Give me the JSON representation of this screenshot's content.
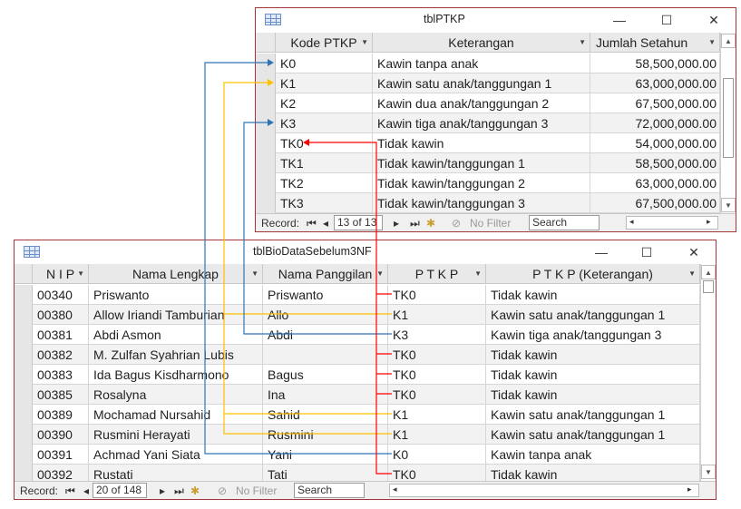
{
  "ptkp": {
    "title": "tblPTKP",
    "columns": [
      "Kode PTKP",
      "Keterangan",
      "Jumlah Setahun"
    ],
    "rows": [
      {
        "kode": "K0",
        "ket": "Kawin tanpa anak",
        "jumlah": "58,500,000.00"
      },
      {
        "kode": "K1",
        "ket": "Kawin satu anak/tanggungan 1",
        "jumlah": "63,000,000.00"
      },
      {
        "kode": "K2",
        "ket": "Kawin dua anak/tanggungan 2",
        "jumlah": "67,500,000.00"
      },
      {
        "kode": "K3",
        "ket": "Kawin tiga anak/tanggungan 3",
        "jumlah": "72,000,000.00"
      },
      {
        "kode": "TK0",
        "ket": "Tidak kawin",
        "jumlah": "54,000,000.00"
      },
      {
        "kode": "TK1",
        "ket": "Tidak kawin/tanggungan 1",
        "jumlah": "58,500,000.00"
      },
      {
        "kode": "TK2",
        "ket": "Tidak kawin/tanggungan 2",
        "jumlah": "63,000,000.00"
      },
      {
        "kode": "TK3",
        "ket": "Tidak kawin/tanggungan 3",
        "jumlah": "67,500,000.00"
      }
    ],
    "nav": {
      "record_label": "Record:",
      "position": "13 of 13",
      "filter": "No Filter",
      "search": "Search"
    }
  },
  "bio": {
    "title": "tblBioDataSebelum3NF",
    "columns": [
      "N I P",
      "Nama Lengkap",
      "Nama Panggilan",
      "P T K P",
      "P T K P (Keterangan)"
    ],
    "rows": [
      {
        "nip": "00340",
        "lengkap": "Priswanto",
        "panggilan": "Priswanto",
        "ptkp": "TK0",
        "ket": "Tidak kawin"
      },
      {
        "nip": "00380",
        "lengkap": "Allow Iriandi Tamburian",
        "panggilan": "Allo",
        "ptkp": "K1",
        "ket": "Kawin satu anak/tanggungan 1"
      },
      {
        "nip": "00381",
        "lengkap": "Abdi Asmon",
        "panggilan": "Abdi",
        "ptkp": "K3",
        "ket": "Kawin tiga anak/tanggungan 3"
      },
      {
        "nip": "00382",
        "lengkap": "M. Zulfan Syahrian Lubis",
        "panggilan": "",
        "ptkp": "TK0",
        "ket": "Tidak kawin"
      },
      {
        "nip": "00383",
        "lengkap": "Ida Bagus Kisdharmono",
        "panggilan": "Bagus",
        "ptkp": "TK0",
        "ket": "Tidak kawin"
      },
      {
        "nip": "00385",
        "lengkap": "Rosalyna",
        "panggilan": "Ina",
        "ptkp": "TK0",
        "ket": "Tidak kawin"
      },
      {
        "nip": "00389",
        "lengkap": "Mochamad Nursahid",
        "panggilan": "Sahid",
        "ptkp": "K1",
        "ket": "Kawin satu anak/tanggungan 1"
      },
      {
        "nip": "00390",
        "lengkap": "Rusmini Herayati",
        "panggilan": "Rusmini",
        "ptkp": "K1",
        "ket": "Kawin satu anak/tanggungan 1"
      },
      {
        "nip": "00391",
        "lengkap": "Achmad Yani Siata",
        "panggilan": "Yani",
        "ptkp": "K0",
        "ket": "Kawin tanpa anak"
      },
      {
        "nip": "00392",
        "lengkap": "Rustati",
        "panggilan": "Tati",
        "ptkp": "TK0",
        "ket": "Tidak kawin"
      }
    ],
    "nav": {
      "record_label": "Record:",
      "position": "20 of 148",
      "filter": "No Filter",
      "search": "Search"
    }
  },
  "window_buttons": {
    "minimize": "—",
    "maximize": "☐",
    "close": "✕"
  },
  "link_colors": {
    "K0": "#2e75b6",
    "K1": "#ffc000",
    "K3": "#2e75b6",
    "TK0": "#ff0000"
  }
}
